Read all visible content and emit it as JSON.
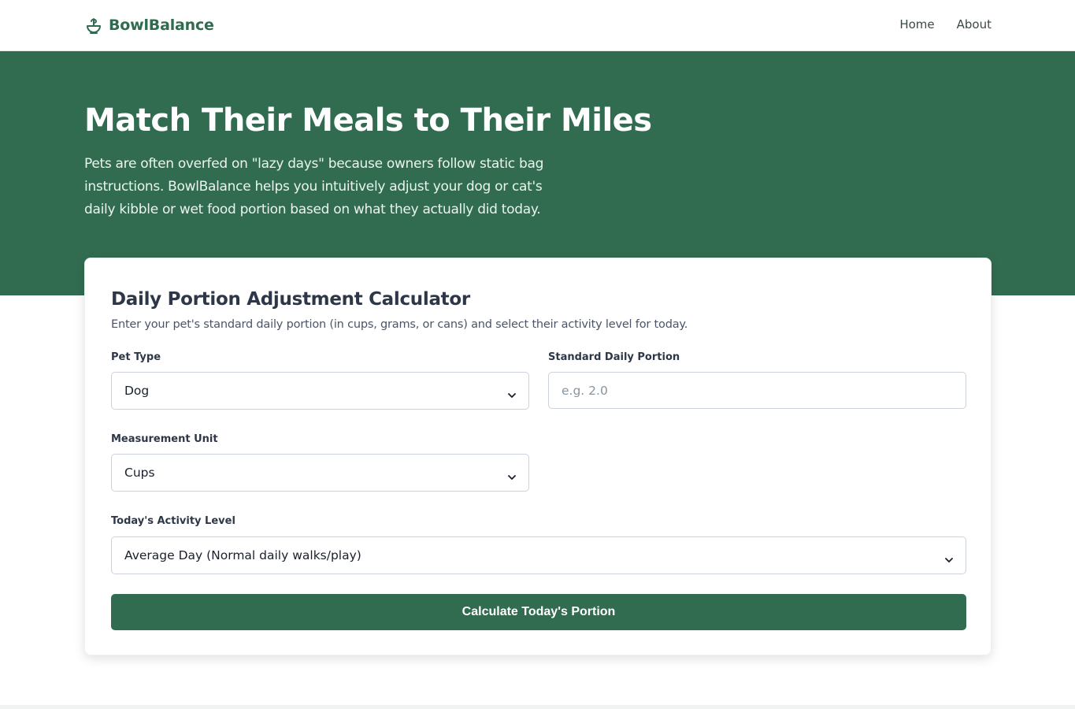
{
  "brand": {
    "name": "BowlBalance",
    "icon": "bowl-icon",
    "color": "#2f6b4f"
  },
  "nav": {
    "items": [
      {
        "label": "Home"
      },
      {
        "label": "About"
      }
    ]
  },
  "hero": {
    "title": "Match Their Meals to Their Miles",
    "description": "Pets are often overfed on \"lazy days\" because owners follow static bag instructions. BowlBalance helps you intuitively adjust your dog or cat's daily kibble or wet food portion based on what they actually did today.",
    "background": "#316c51"
  },
  "calculator": {
    "title": "Daily Portion Adjustment Calculator",
    "subtitle": "Enter your pet's standard daily portion (in cups, grams, or cans) and select their activity level for today.",
    "pet_type": {
      "label": "Pet Type",
      "value": "Dog"
    },
    "standard_portion": {
      "label": "Standard Daily Portion",
      "placeholder": "e.g. 2.0",
      "value": ""
    },
    "unit": {
      "label": "Measurement Unit",
      "value": "Cups"
    },
    "activity": {
      "label": "Today's Activity Level",
      "value": "Average Day (Normal daily walks/play)"
    },
    "button_label": "Calculate Today's Portion"
  }
}
